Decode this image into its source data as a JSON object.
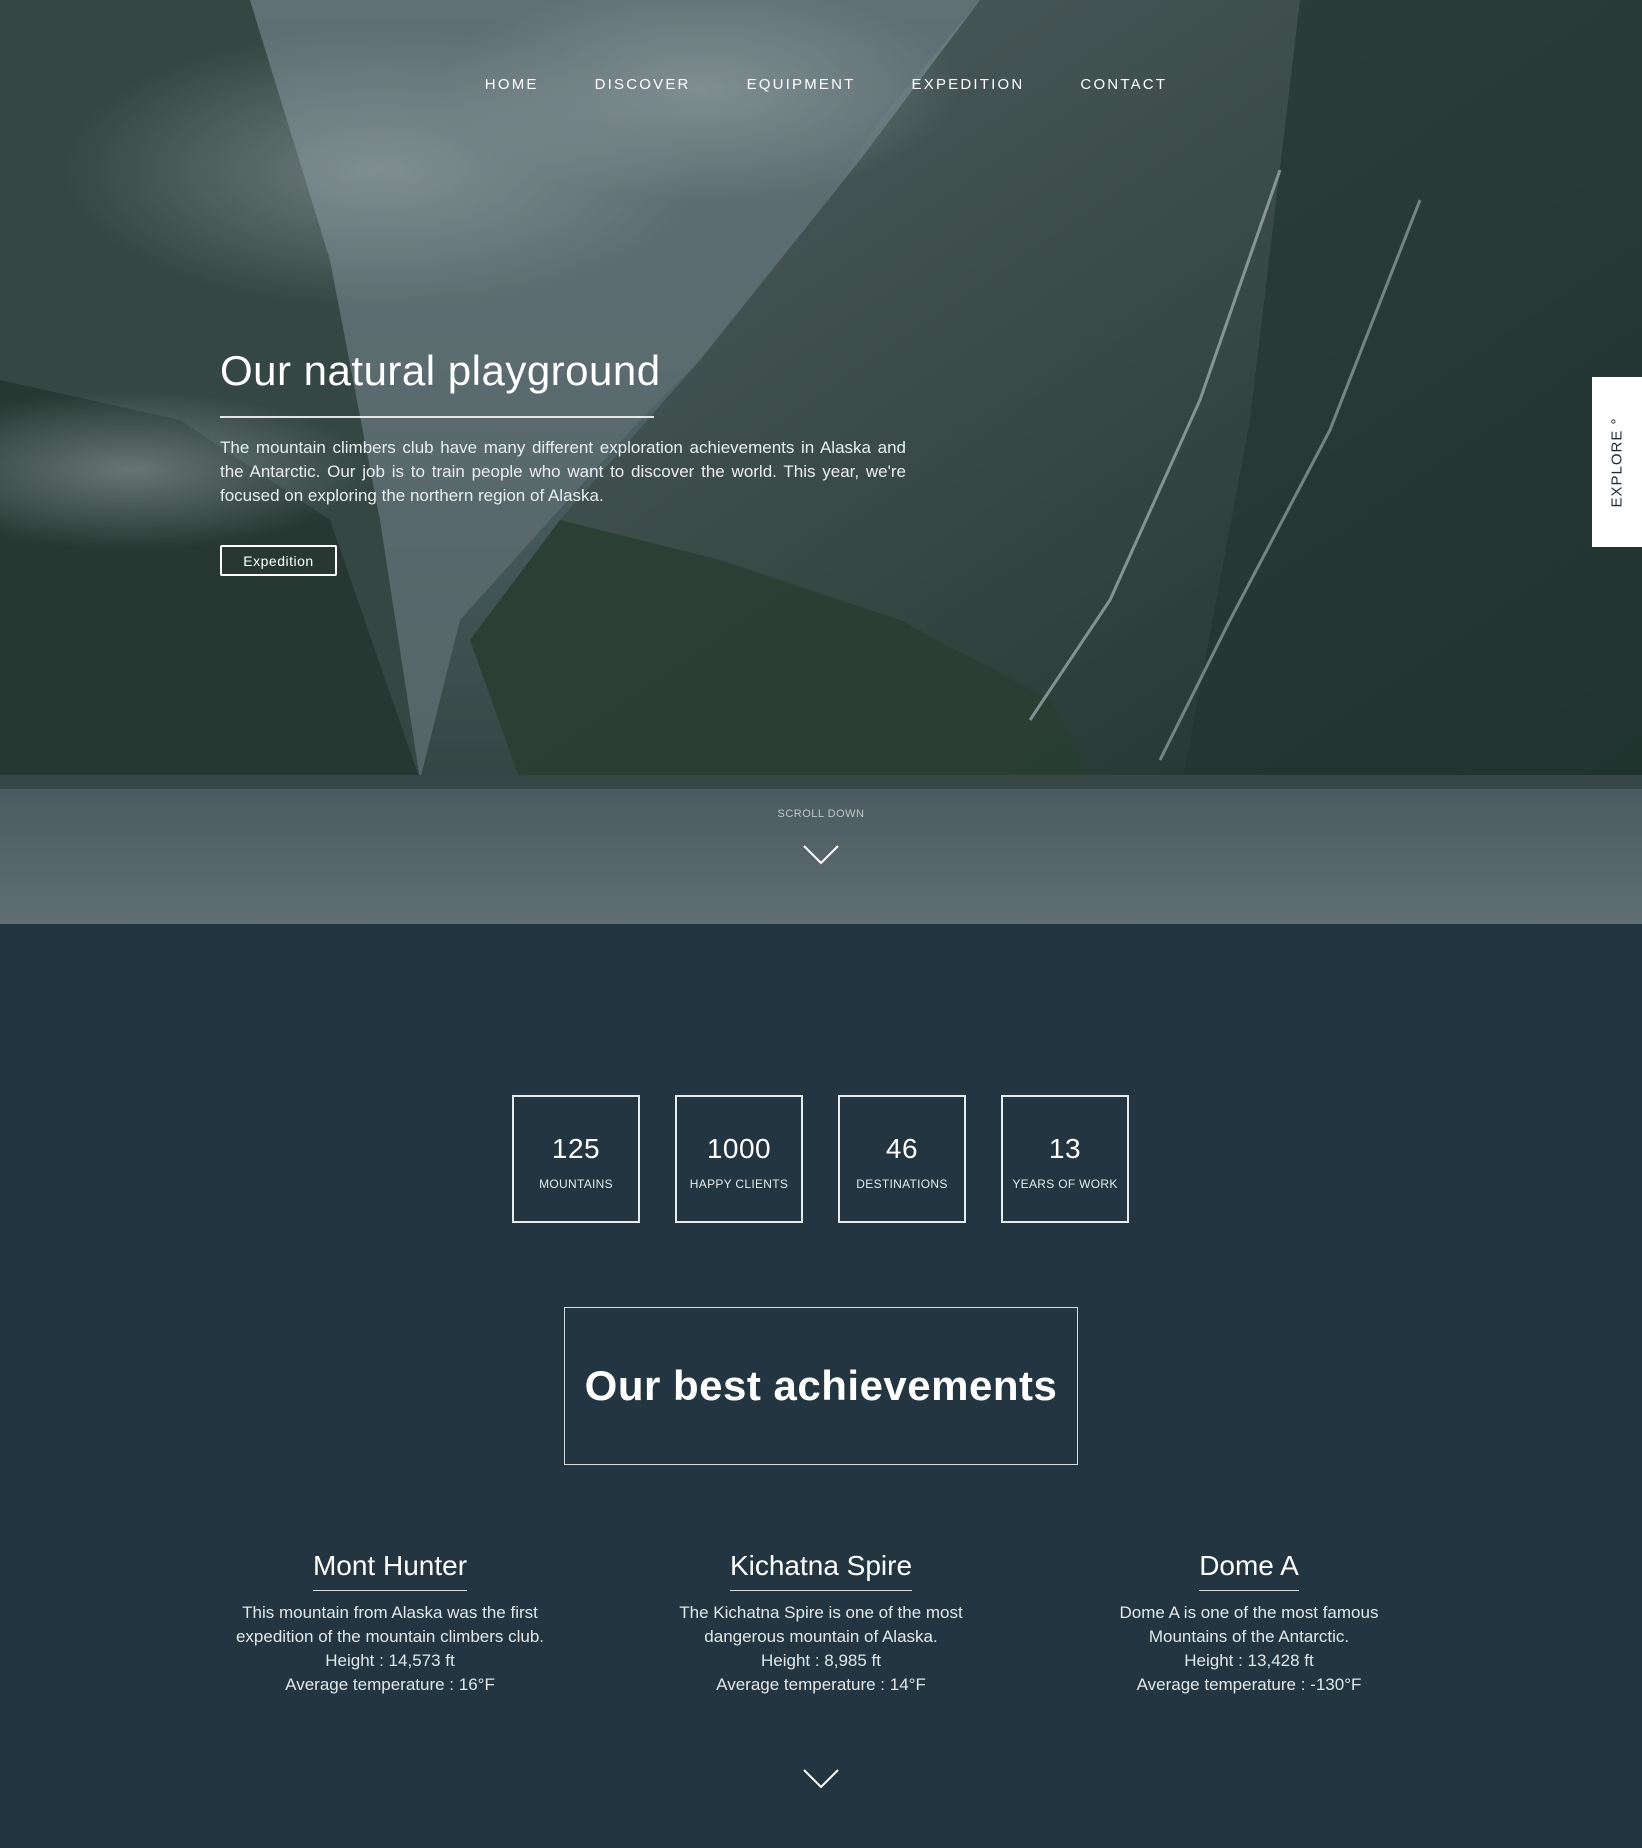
{
  "nav": [
    "HOME",
    "DISCOVER",
    "EQUIPMENT",
    "EXPEDITION",
    "CONTACT"
  ],
  "hero": {
    "title": "Our natural playground",
    "body": "The mountain climbers club have many different exploration achievements in Alaska and the Antarctic. Our job is to train people who want to discover the world. This year, we're focused on exploring the northern region of Alaska.",
    "button": "Expedition",
    "side_tab": "EXPLORE °",
    "scroll_label": "SCROLL DOWN"
  },
  "stats": [
    {
      "value": "125",
      "label": "MOUNTAINS"
    },
    {
      "value": "1000",
      "label": "HAPPY CLIENTS"
    },
    {
      "value": "46",
      "label": "DESTINATIONS"
    },
    {
      "value": "13",
      "label": "YEARS OF WORK"
    }
  ],
  "achievements_title": "Our best achievements",
  "mountains": [
    {
      "name": "Mont Hunter",
      "lines": [
        "This mountain from Alaska was the first",
        "expedition of the mountain climbers club.",
        "Height : 14,573 ft",
        "Average temperature : 16°F"
      ]
    },
    {
      "name": "Kichatna Spire",
      "lines": [
        "The Kichatna Spire is one of the most",
        "dangerous mountain of Alaska.",
        "Height : 8,985 ft",
        "Average temperature : 14°F"
      ]
    },
    {
      "name": "Dome A",
      "lines": [
        "Dome A is one of the most famous",
        "Mountains of the Antarctic.",
        "Height : 13,428 ft",
        "Average temperature : -130°F"
      ]
    }
  ],
  "icons": {
    "scroll": "chevron-down-icon",
    "section": "chevron-down-icon"
  },
  "colors": {
    "background": "#223540",
    "text": "#ffffff",
    "tab": "#ffffff"
  }
}
